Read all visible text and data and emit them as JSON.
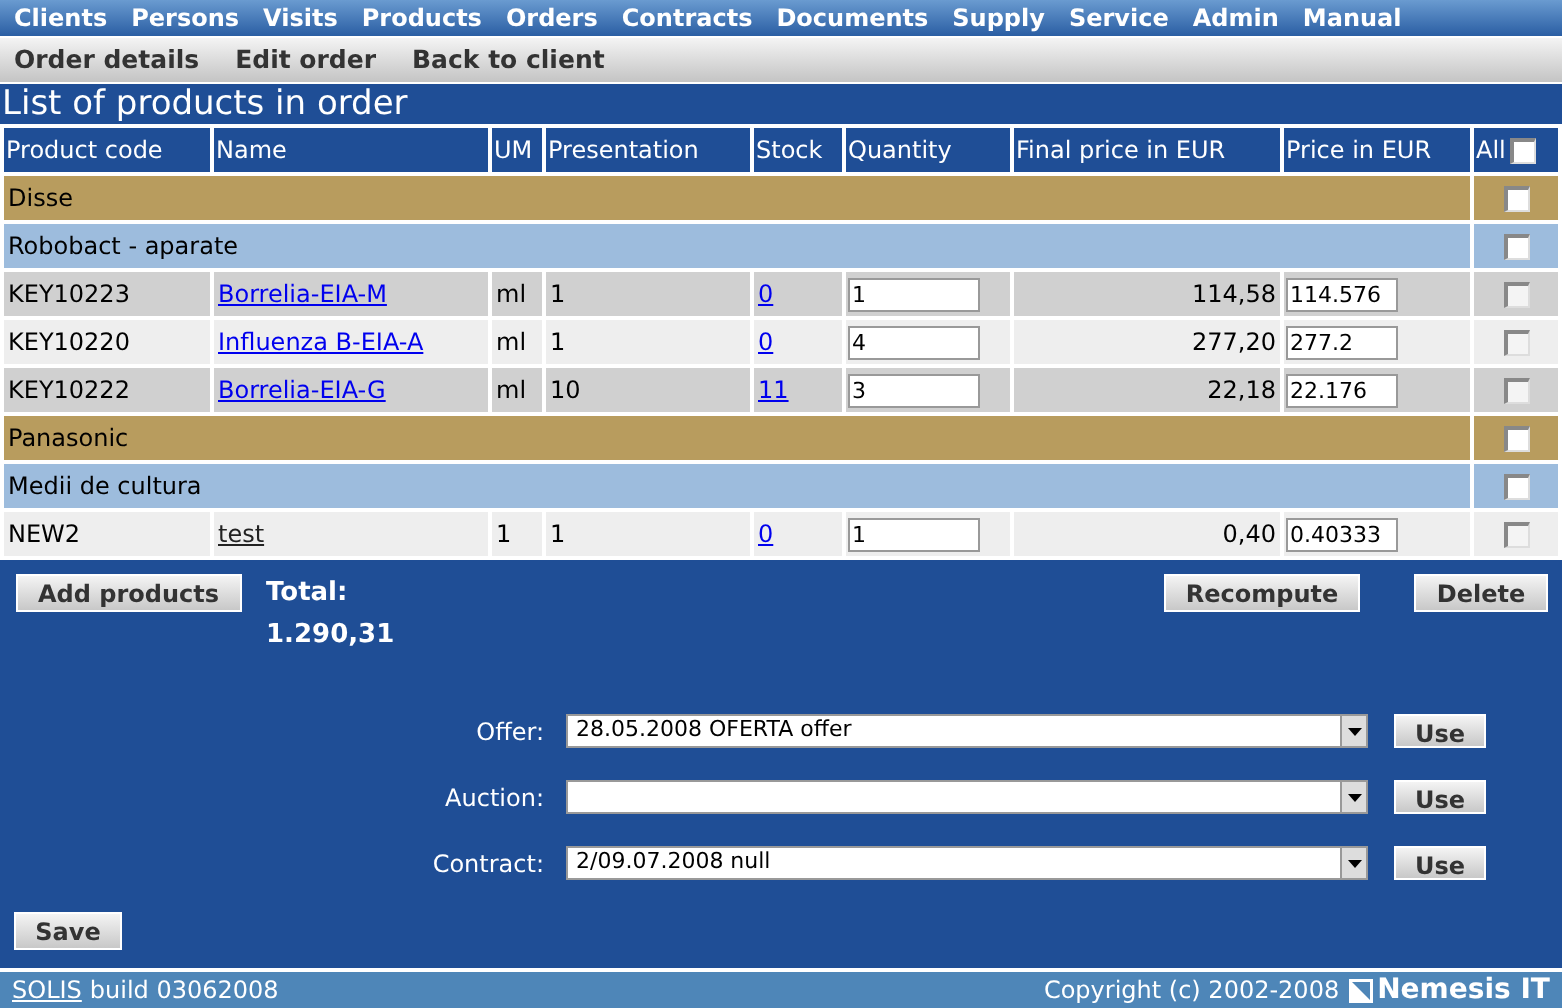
{
  "menu": [
    "Clients",
    "Persons",
    "Visits",
    "Products",
    "Orders",
    "Contracts",
    "Documents",
    "Supply",
    "Service",
    "Admin",
    "Manual"
  ],
  "submenu": [
    "Order details",
    "Edit order",
    "Back to client"
  ],
  "title": "List of products in  order",
  "table": {
    "columns": [
      "Product code",
      "Name",
      "UM",
      "Presentation",
      "Stock",
      "Quantity",
      "Final price in EUR",
      "Price in EUR",
      "All"
    ],
    "all_checked": false,
    "rows": [
      {
        "kind": "supplier",
        "label": "Disse",
        "checked": false
      },
      {
        "kind": "category",
        "label": "Robobact - aparate",
        "checked": false
      },
      {
        "kind": "product",
        "code": "KEY10223",
        "name": "Borrelia-EIA-M",
        "visited": false,
        "um": "ml",
        "presentation": "1",
        "stock": "0",
        "quantity": "1",
        "final_price": "114,58",
        "price": "114.576",
        "checked": false
      },
      {
        "kind": "product",
        "code": "KEY10220",
        "name": "Influenza B-EIA-A",
        "visited": false,
        "um": "ml",
        "presentation": "1",
        "stock": "0",
        "quantity": "4",
        "final_price": "277,20",
        "price": "277.2",
        "checked": false
      },
      {
        "kind": "product",
        "code": "KEY10222",
        "name": "Borrelia-EIA-G",
        "visited": false,
        "um": "ml",
        "presentation": "10",
        "stock": "11",
        "quantity": "3",
        "final_price": "22,18",
        "price": "22.176",
        "checked": false
      },
      {
        "kind": "supplier",
        "label": "Panasonic",
        "checked": false
      },
      {
        "kind": "category",
        "label": "Medii de cultura",
        "checked": false
      },
      {
        "kind": "product",
        "code": "NEW2",
        "name": "test",
        "visited": true,
        "um": "1",
        "presentation": "1",
        "stock": "0",
        "quantity": "1",
        "final_price": "0,40",
        "price": "0.40333",
        "checked": false
      }
    ]
  },
  "buttons": {
    "add": "Add products",
    "recompute": "Recompute",
    "delete": "Delete",
    "save": "Save"
  },
  "total": {
    "label": "Total:",
    "value": "1.290,31"
  },
  "selects": [
    {
      "label": "Offer:",
      "value": "28.05.2008 OFERTA offer",
      "button": "Use"
    },
    {
      "label": "Auction:",
      "button": "Use"
    },
    {
      "label": "Contract:",
      "value": "2/09.07.2008 null",
      "button": "Use"
    }
  ],
  "footer": {
    "link": "SOLIS",
    "build": "build 03062008",
    "copyright": "Copyright (c) 2002-2008",
    "brand": "Nemesis IT"
  }
}
